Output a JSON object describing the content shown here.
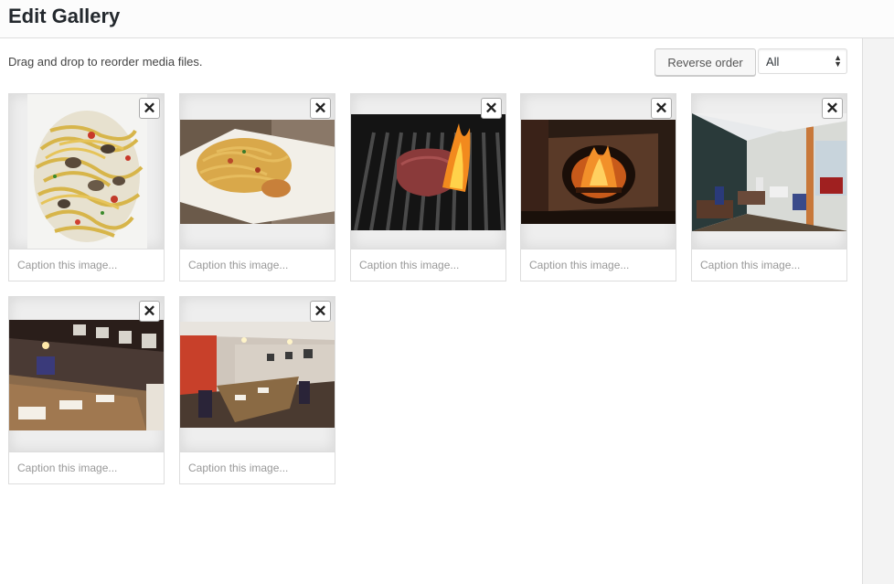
{
  "header": {
    "title": "Edit Gallery"
  },
  "toolbar": {
    "instructions": "Drag and drop to reorder media files.",
    "reverse_label": "Reverse order",
    "filter_selected": "All"
  },
  "gallery": {
    "caption_placeholder": "Caption this image...",
    "items": [
      {
        "subject": "pasta with clams"
      },
      {
        "subject": "pasta plate"
      },
      {
        "subject": "steak on grill"
      },
      {
        "subject": "wood fired oven"
      },
      {
        "subject": "restaurant terrace"
      },
      {
        "subject": "dining room"
      },
      {
        "subject": "dining room interior"
      }
    ]
  }
}
